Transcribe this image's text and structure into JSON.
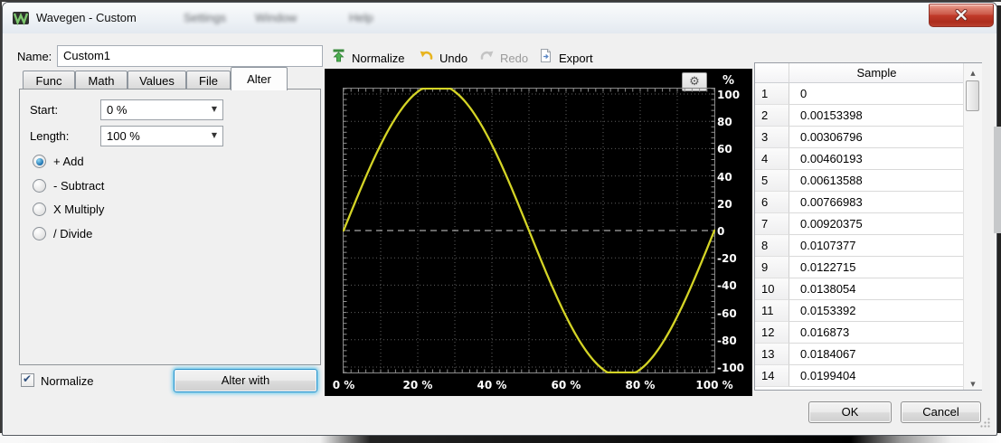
{
  "window": {
    "title": "Wavegen - Custom",
    "background_menu_items": [
      "Settings",
      "Window",
      "Help"
    ]
  },
  "header": {
    "name_label": "Name:",
    "name_value": "Custom1"
  },
  "toolbar": {
    "normalize": "Normalize",
    "undo": "Undo",
    "redo": "Redo",
    "export": "Export",
    "redo_enabled": false
  },
  "tabs": {
    "active": "Alter",
    "items": [
      {
        "label": "Func"
      },
      {
        "label": "Math"
      },
      {
        "label": "Values"
      },
      {
        "label": "File"
      },
      {
        "label": "Alter"
      }
    ]
  },
  "alter_panel": {
    "start_label": "Start:",
    "start_value": "0 %",
    "length_label": "Length:",
    "length_value": "100 %",
    "operations": [
      {
        "label": "+ Add",
        "selected": true
      },
      {
        "label": "- Subtract",
        "selected": false
      },
      {
        "label": "X Multiply",
        "selected": false
      },
      {
        "label": "/ Divide",
        "selected": false
      }
    ],
    "normalize_label": "Normalize",
    "normalize_checked": true,
    "alter_with_label": "Alter with"
  },
  "chart_data": {
    "type": "line",
    "description": "One full period of a sine wave, amplitude 100 %, peaks slightly clipped at the plot edges",
    "x_ticks": [
      "0 %",
      "20 %",
      "40 %",
      "60 %",
      "80 %",
      "100 %"
    ],
    "y_ticks": [
      "100",
      "80",
      "60",
      "40",
      "20",
      "0",
      "-20",
      "-40",
      "-60",
      "-80",
      "-100"
    ],
    "y_unit": "%",
    "xlim_percent": [
      0,
      100
    ],
    "ylim_percent": [
      -104,
      104
    ],
    "grid": "dotted",
    "zero_line": "dashed",
    "plot_bg": "#000000",
    "line_color": "#d4d426",
    "series": [
      {
        "name": "Custom1",
        "shape": "sine",
        "periods": 1,
        "amplitude": 107,
        "clip": 104
      }
    ]
  },
  "sample_table": {
    "header": "Sample",
    "rows": [
      {
        "index": "1",
        "value": "0"
      },
      {
        "index": "2",
        "value": "0.00153398"
      },
      {
        "index": "3",
        "value": "0.00306796"
      },
      {
        "index": "4",
        "value": "0.00460193"
      },
      {
        "index": "5",
        "value": "0.00613588"
      },
      {
        "index": "6",
        "value": "0.00766983"
      },
      {
        "index": "7",
        "value": "0.00920375"
      },
      {
        "index": "8",
        "value": "0.0107377"
      },
      {
        "index": "9",
        "value": "0.0122715"
      },
      {
        "index": "10",
        "value": "0.0138054"
      },
      {
        "index": "11",
        "value": "0.0153392"
      },
      {
        "index": "12",
        "value": "0.016873"
      },
      {
        "index": "13",
        "value": "0.0184067"
      },
      {
        "index": "14",
        "value": "0.0199404"
      }
    ]
  },
  "footer": {
    "ok": "OK",
    "cancel": "Cancel"
  },
  "icons": {
    "gear_icon": "⚙",
    "scroll_up_icon": "▲",
    "scroll_down_icon": "▼",
    "dropdown_arrow_icon": "▼",
    "checkmark_icon": "✔"
  },
  "colors": {
    "accent_focus": "#3dbce8",
    "curve": "#d4d426",
    "close_red": "#c13b2a",
    "dialog_bg": "#f0f0f0"
  }
}
